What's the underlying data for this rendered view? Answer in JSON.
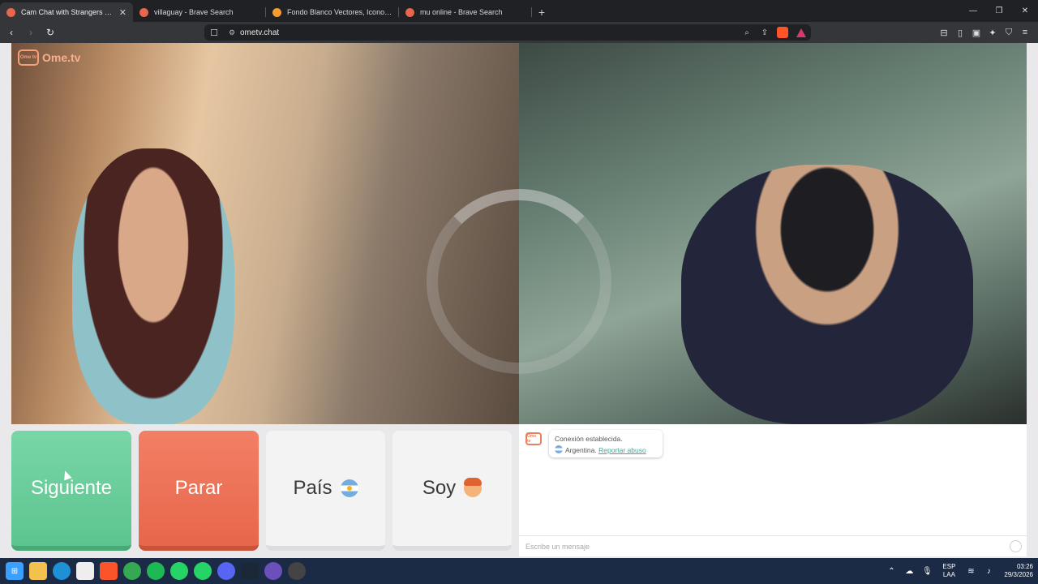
{
  "browser": {
    "tabs": [
      {
        "title": "Cam Chat with Strangers on O",
        "active": true,
        "favicon_color": "#e8664b"
      },
      {
        "title": "villaguay - Brave Search",
        "active": false,
        "favicon_color": "#e8664b"
      },
      {
        "title": "Fondo Blanco Vectores, Iconos, Gráfi",
        "active": false,
        "favicon_color": "#f59b2f"
      },
      {
        "title": "mu online - Brave Search",
        "active": false,
        "favicon_color": "#e8664b"
      }
    ],
    "new_tab": "+",
    "url": "ometv.chat"
  },
  "page": {
    "logo_badge": "Ome tv",
    "logo_text": "Ome.tv",
    "buttons": {
      "next": "Siguiente",
      "stop": "Parar",
      "country": "País",
      "soy": "Soy"
    },
    "chat": {
      "status": "Conexión establecida.",
      "country": "Argentina.",
      "report": "Reportar abuso",
      "placeholder": "Escribe un mensaje"
    }
  },
  "taskbar": {
    "lang_1": "ESP",
    "lang_2": "LAA",
    "time": "03:26",
    "date": "29/3/2026"
  },
  "colors": {
    "next": "#5cc58f",
    "stop": "#e8664b",
    "accent": "#3aa8a0"
  }
}
